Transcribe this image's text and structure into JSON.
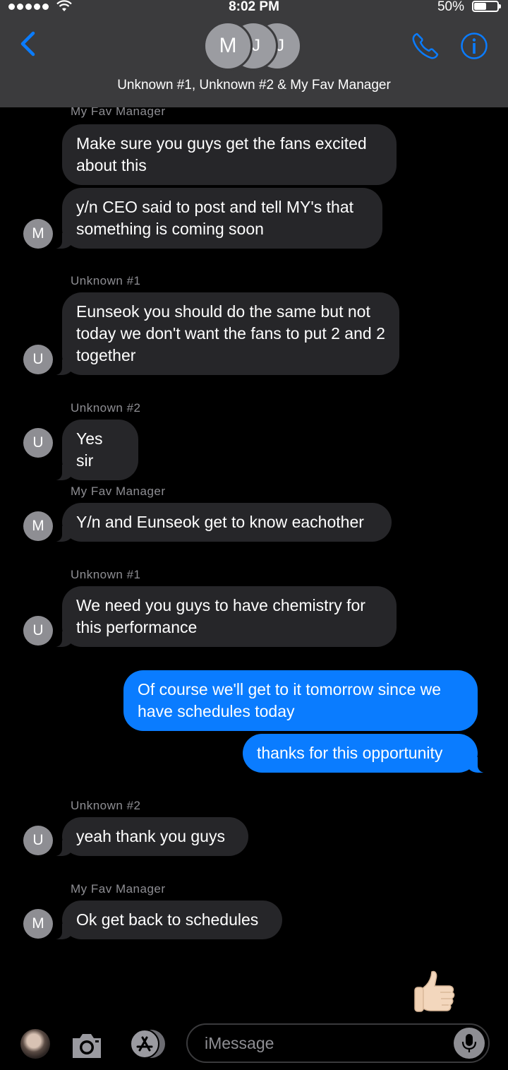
{
  "status_bar": {
    "time": "8:02 PM",
    "battery_pct": "50%"
  },
  "header": {
    "group_initials": [
      "M",
      "J",
      "J"
    ],
    "title": "Unknown #1, Unknown #2 & My Fav Manager"
  },
  "colors": {
    "accent": "#0a7cff",
    "incoming_bubble": "#262629",
    "header_bg": "#3b3b3d",
    "sender_label": "#8e8e93"
  },
  "messages": {
    "m1_sender": "My Fav Manager",
    "m1_text": "Make sure you guys get the fans excited about this",
    "m2_text": "y/n CEO said to post and tell MY's that something is coming soon",
    "m2_avatar": "M",
    "m3_sender": "Unknown #1",
    "m3_text": "Eunseok you should do the same but not today we don't want the fans to put 2 and 2 together",
    "m3_avatar": "U",
    "m4_sender": "Unknown #2",
    "m4_text": "Yes sir",
    "m4_avatar": "U",
    "m5_sender": "My Fav Manager",
    "m5_text": "Y/n and Eunseok get to know eachother",
    "m5_avatar": "M",
    "m6_sender": "Unknown #1",
    "m6_text": "We need you guys to have chemistry for this performance",
    "m6_avatar": "U",
    "m7_text": "Of course we'll get to it tomorrow since we have schedules today",
    "m8_text": "thanks for this opportunity",
    "m9_sender": "Unknown #2",
    "m9_text": "yeah thank you guys",
    "m9_avatar": "U",
    "m10_sender": "My Fav Manager",
    "m10_text": "Ok get back to schedules",
    "m10_avatar": "M"
  },
  "input": {
    "placeholder": "iMessage"
  },
  "icons": [
    "back-chevron-icon",
    "phone-icon",
    "info-icon",
    "thumbs-up-icon",
    "camera-icon",
    "app-store-icon",
    "microphone-icon"
  ]
}
